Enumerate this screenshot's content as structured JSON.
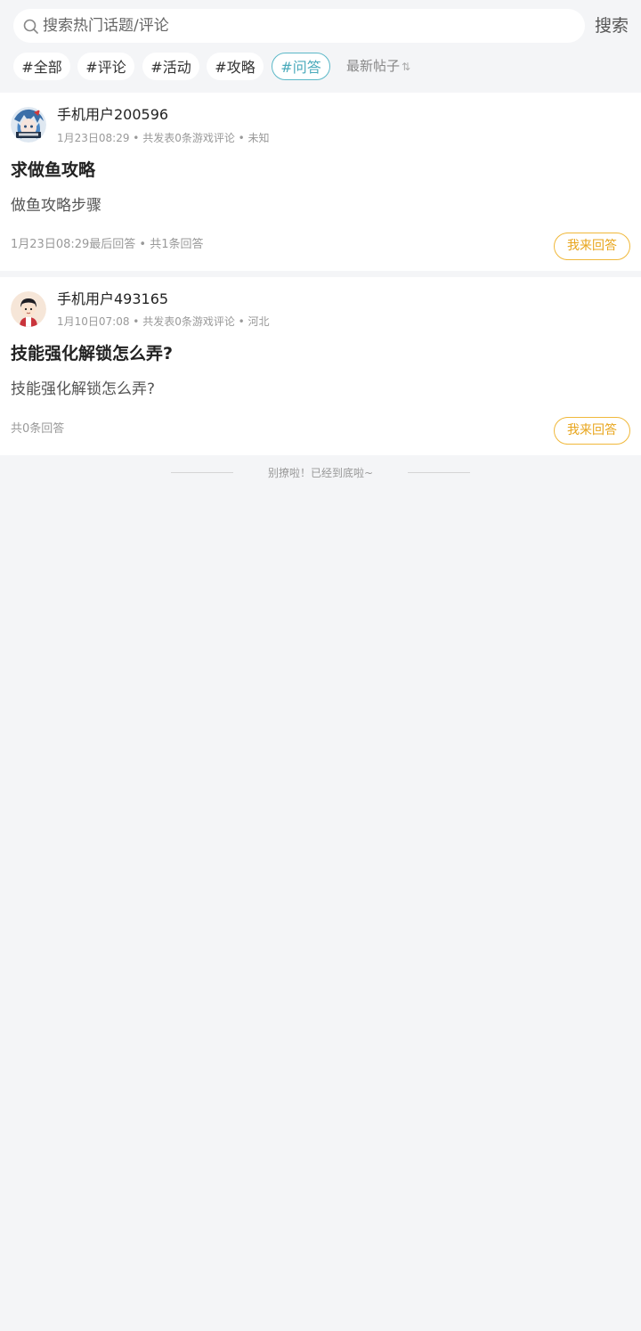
{
  "search": {
    "placeholder": "搜索热门话题/评论",
    "value": "",
    "button_label": "搜索"
  },
  "tabs": [
    {
      "label": "#全部",
      "active": false
    },
    {
      "label": "#评论",
      "active": false
    },
    {
      "label": "#活动",
      "active": false
    },
    {
      "label": "#攻略",
      "active": false
    },
    {
      "label": "#问答",
      "active": true
    }
  ],
  "sort": {
    "label": "最新帖子",
    "icon": "sort-arrows-icon",
    "icon_glyph": "⇅"
  },
  "posts": [
    {
      "username": "手机用户200596",
      "meta": "1月23日08:29 • 共发表0条游戏评论 • 未知",
      "title": "求做鱼攻略",
      "body": "做鱼攻略步骤",
      "footer": "1月23日08:29最后回答 • 共1条回答",
      "answer_label": "我来回答",
      "avatar": "anime-character-avatar"
    },
    {
      "username": "手机用户493165",
      "meta": "1月10日07:08 • 共发表0条游戏评论 • 河北",
      "title": "技能强化解锁怎么弄?",
      "body": "技能强化解锁怎么弄?",
      "footer": "共0条回答",
      "answer_label": "我来回答",
      "avatar": "cartoon-boy-avatar"
    }
  ],
  "end_message": "别撩啦！已经到底啦~",
  "colors": {
    "background": "#f4f5f7",
    "active_tab": "#4aaabb",
    "answer_button": "#e8a51b"
  }
}
